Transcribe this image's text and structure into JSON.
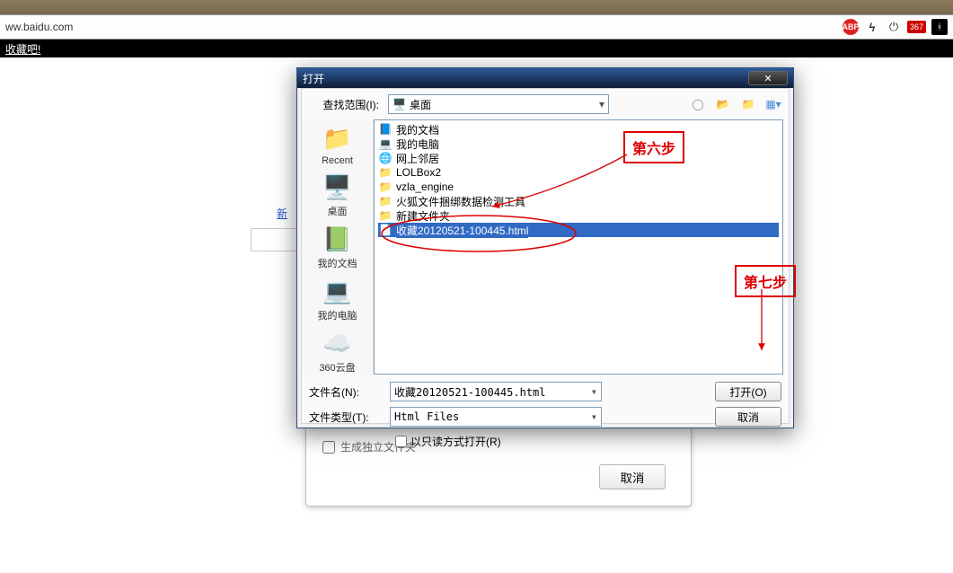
{
  "browser": {
    "url": "ww.baidu.com",
    "icons": {
      "abp": "ABP",
      "dev_count": "367"
    },
    "bookmark_text": "收藏吧!"
  },
  "page_fragment": {
    "blue_link": "新"
  },
  "lower_dialog": {
    "checkbox_label": "生成独立文件夹",
    "cancel_label": "取消"
  },
  "open_dialog": {
    "title": "打开",
    "lookin_label": "查找范围(I):",
    "lookin_value": "桌面",
    "places": [
      {
        "label": "Recent"
      },
      {
        "label": "桌面"
      },
      {
        "label": "我的文档"
      },
      {
        "label": "我的电脑"
      },
      {
        "label": "360云盘"
      }
    ],
    "files": [
      {
        "icon": "doc",
        "name": "我的文档"
      },
      {
        "icon": "pc",
        "name": "我的电脑"
      },
      {
        "icon": "net",
        "name": "网上邻居"
      },
      {
        "icon": "folder",
        "name": "LOLBox2"
      },
      {
        "icon": "folder",
        "name": "vzla_engine"
      },
      {
        "icon": "folder",
        "name": "火狐文件捆绑数据检测工具"
      },
      {
        "icon": "folder",
        "name": "新建文件夹"
      },
      {
        "icon": "ie",
        "name": "收藏20120521-100445.html",
        "selected": true
      }
    ],
    "filename_label": "文件名(N):",
    "filename_value": "收藏20120521-100445.html",
    "filetype_label": "文件类型(T):",
    "filetype_value": "Html Files",
    "readonly_label": "以只读方式打开(R)",
    "open_btn": "打开(O)",
    "cancel_btn": "取消"
  },
  "annotations": {
    "step6": "第六步",
    "step7": "第七步"
  }
}
